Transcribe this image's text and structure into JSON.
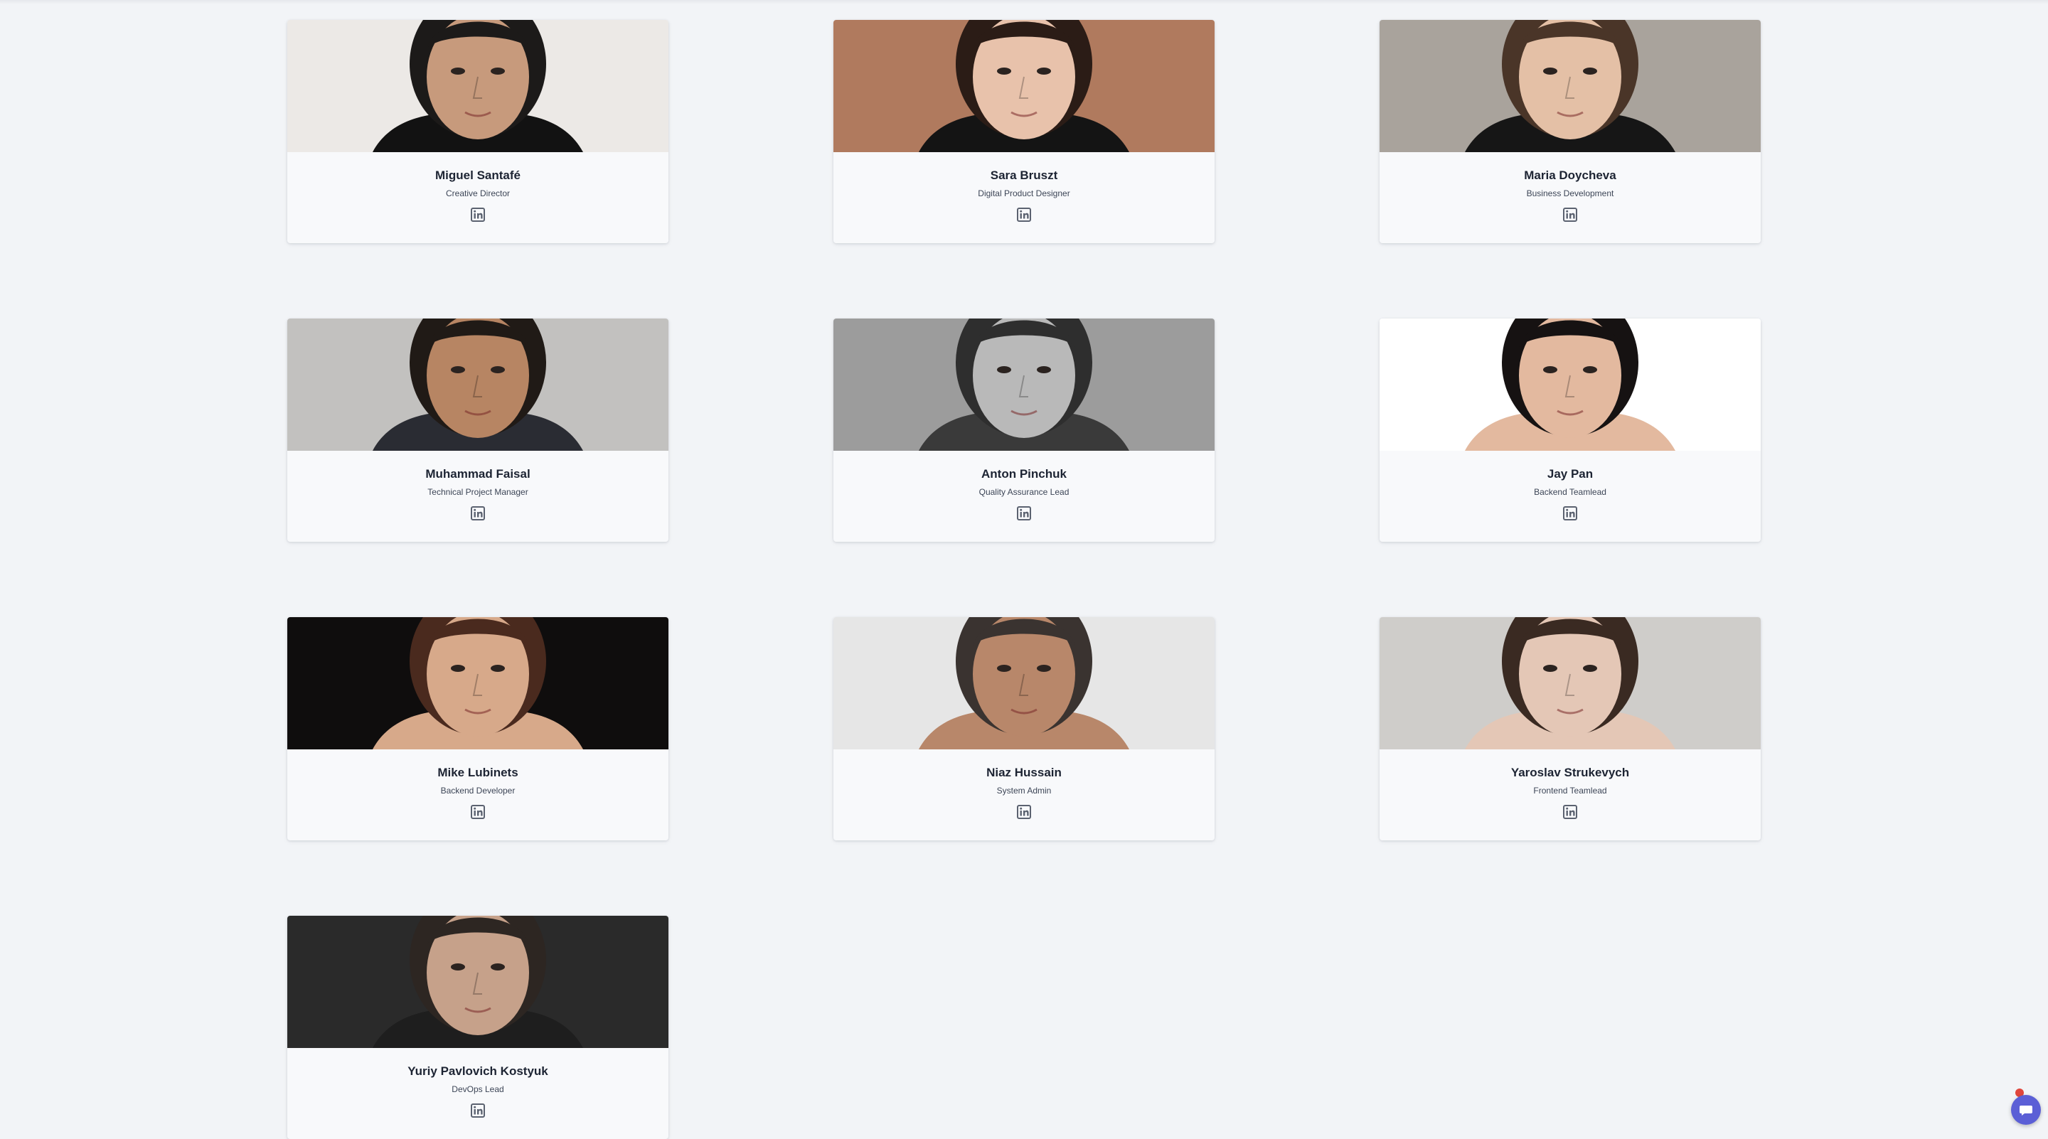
{
  "team": [
    {
      "name": "Miguel Santafé",
      "role": "Creative Director",
      "bg": "#ece9e6",
      "skin": "#c79a7c",
      "hair": "#1c1a19",
      "shirt": "#121212"
    },
    {
      "name": "Sara Bruszt",
      "role": "Digital Product Designer",
      "bg": "#b07a5e",
      "skin": "#e8c2ab",
      "hair": "#2b1c16",
      "shirt": "#141414"
    },
    {
      "name": "Maria Doycheva",
      "role": "Business Development",
      "bg": "#a9a39c",
      "skin": "#e4c0a6",
      "hair": "#4a3528",
      "shirt": "#161616"
    },
    {
      "name": "Muhammad Faisal",
      "role": "Technical Project Manager",
      "bg": "#c2c1bf",
      "skin": "#b78563",
      "hair": "#201a16",
      "shirt": "#2a2c33"
    },
    {
      "name": "Anton Pinchuk",
      "role": "Quality Assurance Lead",
      "bg": "#9c9c9c",
      "skin": "#b9b9b9",
      "hair": "#2e2e2e",
      "shirt": "#3a3a3a"
    },
    {
      "name": "Jay Pan",
      "role": "Backend Teamlead",
      "bg": "#ffffff",
      "skin": "#e3b99f",
      "hair": "#161212",
      "shirt": "#e3b99f"
    },
    {
      "name": "Mike Lubinets",
      "role": "Backend Developer",
      "bg": "#0f0d0d",
      "skin": "#d7a98a",
      "hair": "#4a2a1e",
      "shirt": "#d7a98a"
    },
    {
      "name": "Niaz Hussain",
      "role": "System Admin",
      "bg": "#e6e6e6",
      "skin": "#b8876a",
      "hair": "#3a3330",
      "shirt": "#b8876a"
    },
    {
      "name": "Yaroslav Strukevych",
      "role": "Frontend Teamlead",
      "bg": "#cfcdca",
      "skin": "#e4c7b6",
      "hair": "#3a2a22",
      "shirt": "#e4c7b6"
    },
    {
      "name": "Yuriy Pavlovich Kostyuk",
      "role": "DevOps Lead",
      "bg": "#2a2a2a",
      "skin": "#c6a18a",
      "hair": "#2d2622",
      "shirt": "#1e1e1e"
    }
  ],
  "icons": {
    "social": "linkedin-icon",
    "chat": "chat-icon"
  },
  "colors": {
    "page_background": "#f2f4f7",
    "card_background": "#f8f9fb",
    "chat_accent": "#5b5fd6"
  }
}
